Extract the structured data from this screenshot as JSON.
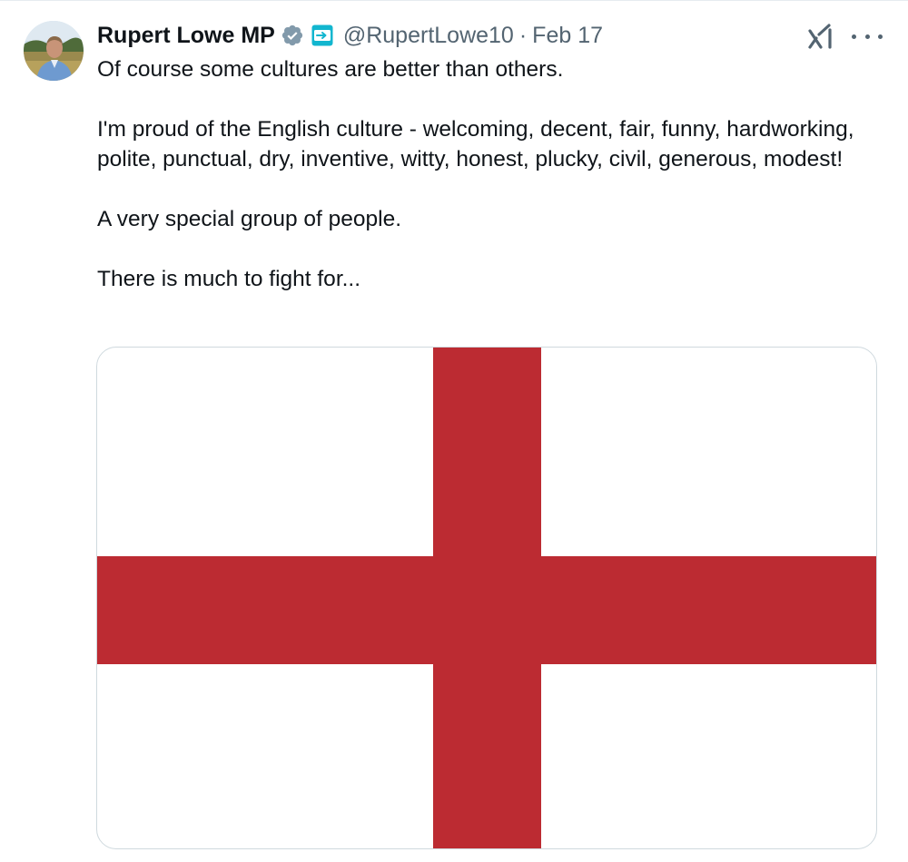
{
  "author": {
    "display_name": "Rupert Lowe MP",
    "handle": "@RupertLowe10",
    "separator": "·",
    "date": "Feb 17",
    "verified_icon": "verified-badge-icon",
    "affiliation_icon": "reform-uk-badge-icon"
  },
  "tweet": {
    "paragraphs": [
      "Of course some cultures are better than others.",
      "I'm proud of the English culture - welcoming, decent, fair, funny, hardworking, polite, punctual, dry, inventive, witty, honest, plucky, civil, generous, modest!",
      "A very special group of people.",
      "There is much to fight for..."
    ]
  },
  "media": {
    "type": "image",
    "subject": "flag-of-england",
    "cross_color": "#bc2b32",
    "field_color": "#ffffff"
  },
  "actions": {
    "grok_icon": "grok-icon",
    "more_icon": "more-options-icon"
  },
  "colors": {
    "text_primary": "#0f1419",
    "text_secondary": "#536471",
    "verified_badge": "#829aab",
    "border": "#cfd9de"
  }
}
